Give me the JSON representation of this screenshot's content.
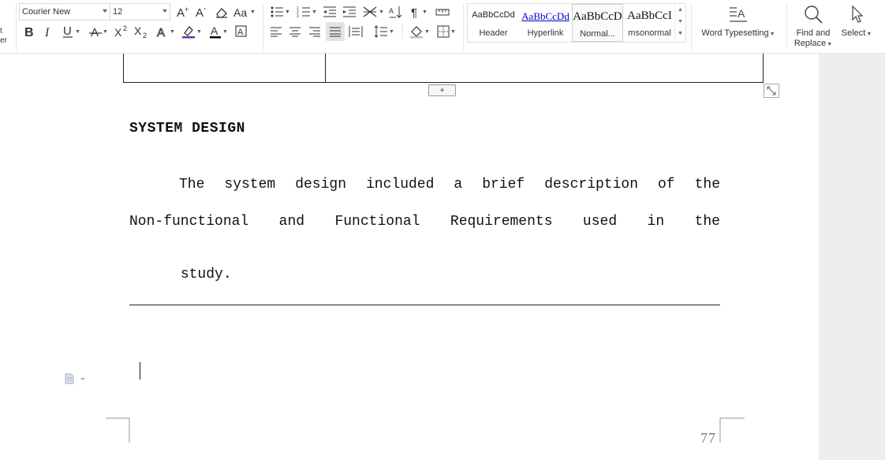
{
  "ribbon": {
    "left_cut_text": [
      "t",
      "er"
    ],
    "font": {
      "family": "Courier New",
      "size": "12"
    },
    "styles": [
      {
        "sample": "AaBbCcDd",
        "name": "Header"
      },
      {
        "sample": "AaBbCcDd",
        "name": "Hyperlink"
      },
      {
        "sample": "AaBbCcD",
        "name": "Normal..."
      },
      {
        "sample": "AaBbCcI",
        "name": "msonormal"
      }
    ],
    "word_typesetting": "Word Typesetting",
    "find_replace": [
      "Find and",
      "Replace"
    ],
    "select": "Select",
    "colors": {
      "font_color": "#000000",
      "highlight": "#7030a0",
      "hyperlink": "#0000cc"
    }
  },
  "document": {
    "heading": "SYSTEM DESIGN",
    "paragraph_lines": [
      [
        "The",
        "system",
        "design",
        "included",
        "a",
        "brief",
        "description",
        "of",
        "the"
      ],
      [
        "Non-functional",
        "and",
        "Functional",
        "Requirements",
        "used",
        "in",
        "the"
      ],
      [
        "study."
      ]
    ],
    "add_row_label": "+",
    "page_number": "77"
  }
}
